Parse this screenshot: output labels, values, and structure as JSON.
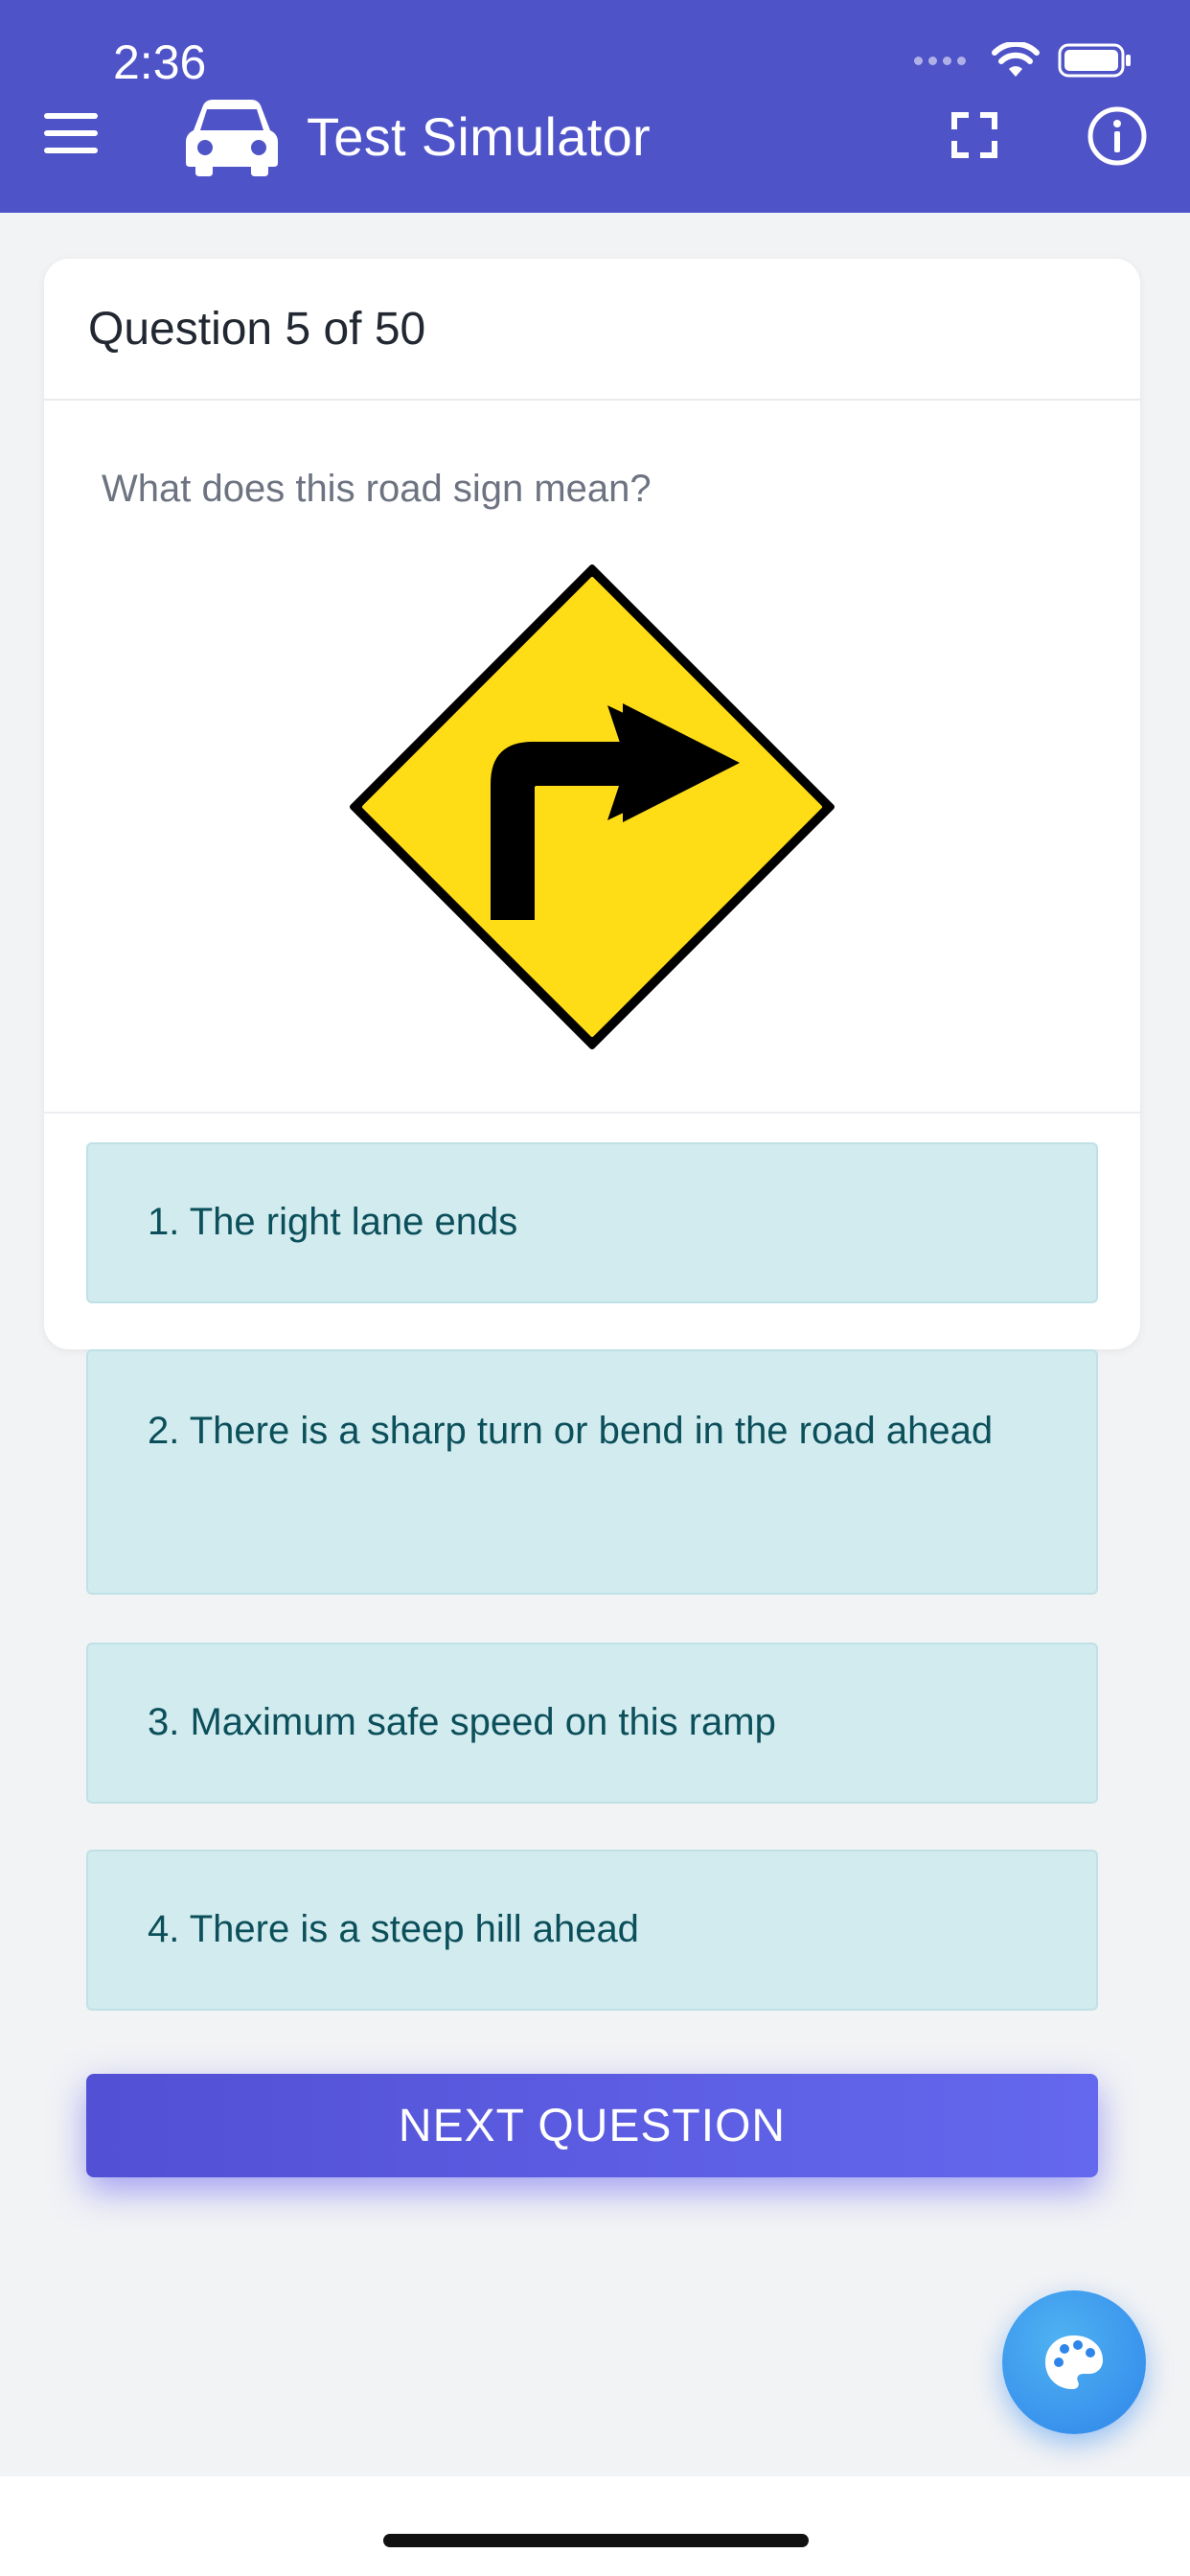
{
  "status_bar": {
    "time": "2:36"
  },
  "header": {
    "title": "Test Simulator",
    "icons": [
      "menu-icon",
      "car-icon",
      "fullscreen-icon",
      "info-icon"
    ],
    "background": "#4f53c8"
  },
  "card": {
    "question_counter": "Question 5 of 50",
    "question_text": "What does this road sign mean?",
    "sign": {
      "type": "right-turn-warning",
      "color": "#fedd17"
    },
    "answers": [
      {
        "label": "1. The right lane ends"
      },
      {
        "label": "2. There is a sharp turn or bend in the road ahead"
      },
      {
        "label": "3. Maximum safe speed on this ramp"
      },
      {
        "label": "4. There is a steep hill ahead"
      }
    ],
    "next_button": "NEXT QUESTION"
  },
  "fab": {
    "icon": "palette-icon",
    "color": "#2f86ea"
  }
}
